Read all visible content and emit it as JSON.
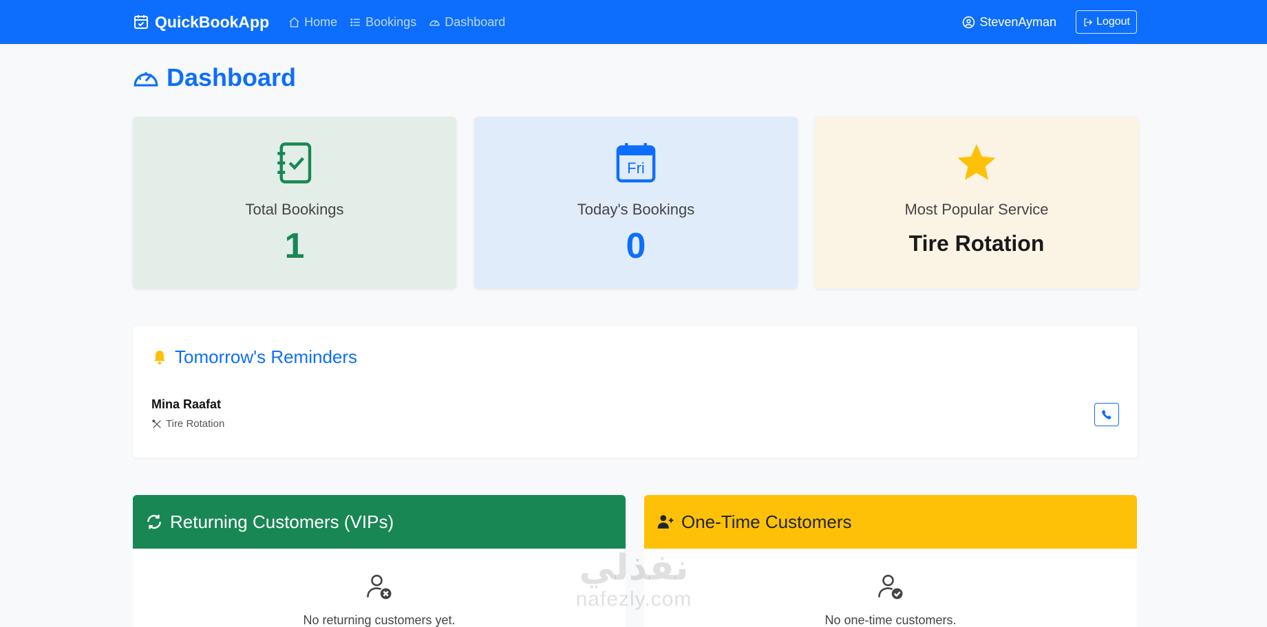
{
  "navbar": {
    "brand": "QuickBookApp",
    "links": [
      {
        "label": "Home",
        "icon": "house-icon"
      },
      {
        "label": "Bookings",
        "icon": "list-icon"
      },
      {
        "label": "Dashboard",
        "icon": "speedometer-icon"
      }
    ],
    "user": "StevenAyman",
    "logout": "Logout"
  },
  "page": {
    "title": "Dashboard"
  },
  "stats": [
    {
      "label": "Total Bookings",
      "value": "1",
      "icon": "journal-check-icon",
      "color": "#198754"
    },
    {
      "label": "Today's Bookings",
      "value": "0",
      "icon": "calendar-day-icon",
      "icon_text": "Fri",
      "color": "#0d6efd"
    },
    {
      "label": "Most Popular Service",
      "value": "Tire Rotation",
      "icon": "star-icon",
      "color": "#ffc107"
    }
  ],
  "reminders": {
    "title": "Tomorrow's Reminders",
    "items": [
      {
        "name": "Mina Raafat",
        "service": "Tire Rotation"
      }
    ]
  },
  "customers": {
    "returning": {
      "title": "Returning Customers (VIPs)",
      "empty": "No returning customers yet."
    },
    "one_time": {
      "title": "One-Time Customers",
      "empty": "No one-time customers."
    }
  },
  "watermark": {
    "arabic": "نفذلي",
    "latin": "nafezly.com"
  },
  "colors": {
    "primary": "#0d6efd",
    "success": "#198754",
    "warning": "#ffc107"
  }
}
